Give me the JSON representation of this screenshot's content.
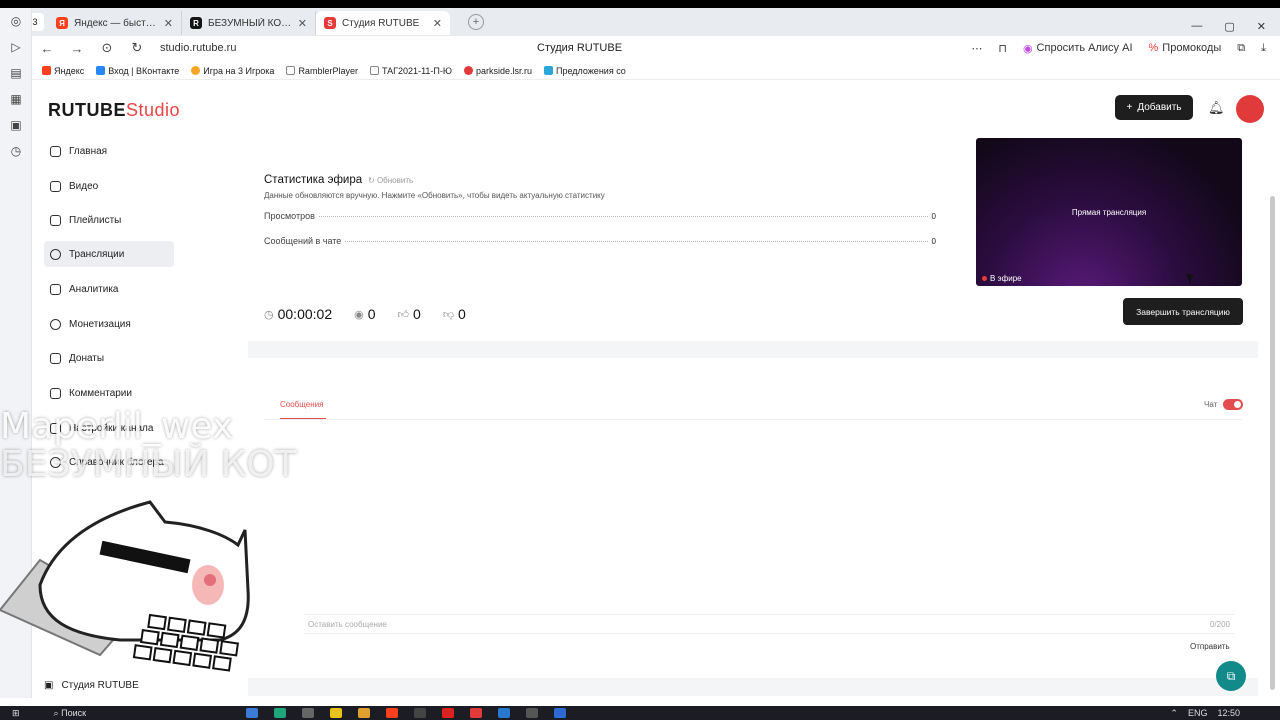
{
  "browser": {
    "tab_count": "3",
    "tabs": [
      {
        "label": "Яндекс — быстрый поиск",
        "icon": "yandex-icon",
        "color": "#fc3f1d"
      },
      {
        "label": "БЕЗУМНЫЙ КОТ. Смотреть",
        "icon": "rutube-icon",
        "color": "#141414"
      },
      {
        "label": "Студия RUTUBE",
        "icon": "rutube-icon",
        "color": "#e83a3a"
      }
    ],
    "url": "studio.rutube.ru",
    "page_title": "Студия RUTUBE",
    "ask_alice": "Спросить Алису AI",
    "promo": "Промокоды",
    "bookmarks": [
      {
        "label": "Яндекс",
        "color": "#fc3f1d"
      },
      {
        "label": "Вход | ВКонтакте",
        "color": "#2787f5"
      },
      {
        "label": "Игра на 3 Игрока",
        "color": "#f5a623"
      },
      {
        "label": "RamblerPlayer",
        "color": "#888888"
      },
      {
        "label": "ТАГ2021-11-П-Ю",
        "color": "#888888"
      },
      {
        "label": "parkside.lsr.ru",
        "color": "#e03a3a"
      },
      {
        "label": "Предложения со",
        "color": "#2aa7d8"
      }
    ]
  },
  "header": {
    "logo_main": "RUTUBE",
    "logo_sub": "Studio",
    "add_label": "Добавить"
  },
  "sidebar": {
    "items": [
      {
        "label": "Главная"
      },
      {
        "label": "Видео"
      },
      {
        "label": "Плейлисты"
      },
      {
        "label": "Трансляции"
      },
      {
        "label": "Аналитика"
      },
      {
        "label": "Монетизация"
      },
      {
        "label": "Донаты"
      },
      {
        "label": "Комментарии"
      },
      {
        "label": "Настройки канала"
      },
      {
        "label": "Справочник блогера"
      }
    ],
    "footer": "Студия RUTUBE"
  },
  "stats": {
    "title": "Статистика эфира",
    "refresh": "Обновить",
    "note": "Данные обновляются вручную. Нажмите «Обновить», чтобы видеть актуальную статистику",
    "rows": [
      {
        "label": "Просмотров",
        "value": "0"
      },
      {
        "label": "Сообщений в чате",
        "value": "0"
      }
    ]
  },
  "metrics": {
    "duration": "00:00:02",
    "viewers": "0",
    "likes": "0",
    "dislikes": "0"
  },
  "preview": {
    "title": "Прямая трансляция",
    "live": "В эфире"
  },
  "end_button": "Завершить трансляцию",
  "chat": {
    "tab": "Сообщения",
    "toggle_label": "Чат",
    "placeholder": "Оставить сообщение",
    "counter": "0/200",
    "send": "Отправить"
  },
  "overlay": {
    "line1": "Maperlil_wex",
    "line2": "БЕЗУМНЫЙ КОТ"
  },
  "taskbar": {
    "search": "Поиск",
    "lang": "ENG",
    "time": "12:50"
  },
  "colors": {
    "accent": "#e44d4d",
    "dark_button": "#1e1e1e",
    "help_fab": "#138a8a"
  }
}
